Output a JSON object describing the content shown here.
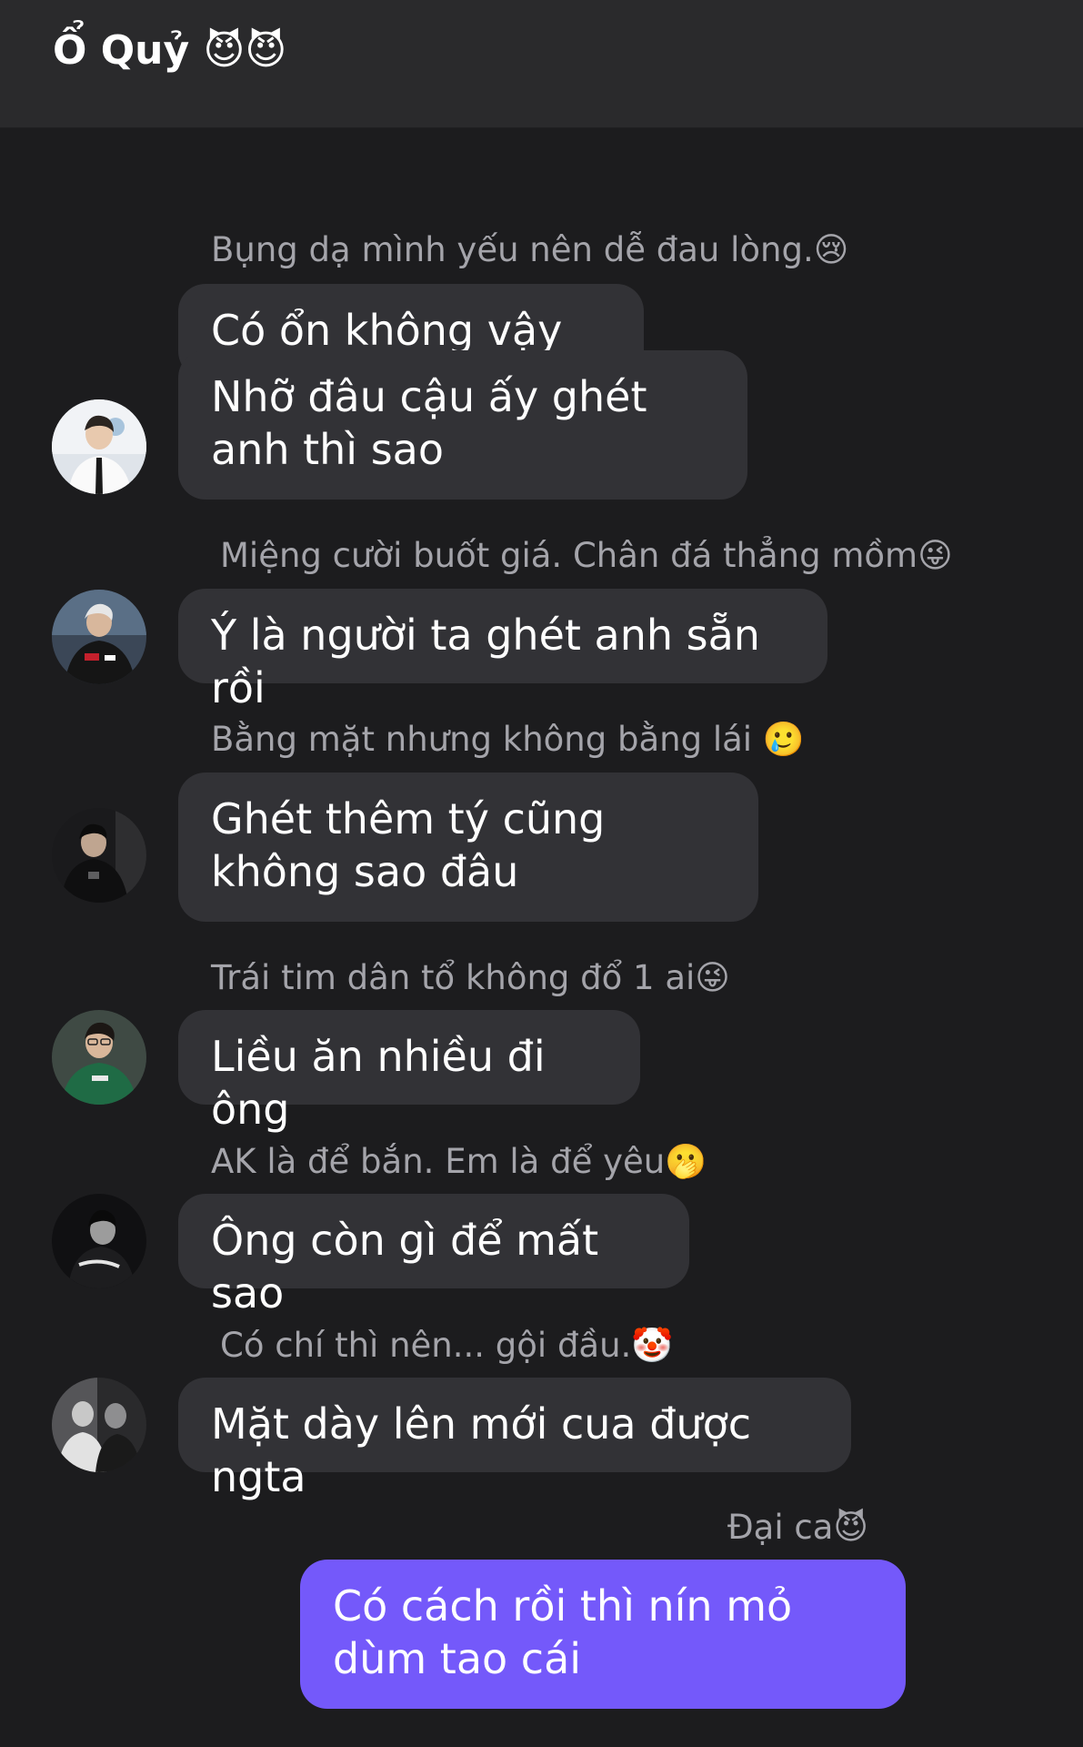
{
  "header": {
    "title": "Ổ Quỷ 😈😈"
  },
  "messages": [
    {
      "sender": "Bụng dạ mình yếu nên dễ đau lòng.😢",
      "text": "Có ổn không vậy 😿",
      "avatar": "avatar-boy-white-shirt",
      "mine": false
    },
    {
      "sender": "Miệng cười buốt giá. Chân đá thẳng mồm😜",
      "text": "Ý là người ta ghét anh sẵn rồi",
      "avatar": "avatar-player-jersey",
      "mine": false
    },
    {
      "sender": "Bằng mặt nhưng không bằng lái 🥲",
      "text": "Ghét thêm tý cũng không sao đâu",
      "avatar": "avatar-dark-photo",
      "mine": false
    },
    {
      "sender": "Trái tim dân tổ không đổ 1 ai😜",
      "text": "Liều ăn nhiều đi ông",
      "avatar": "avatar-green-jersey",
      "mine": false
    },
    {
      "sender": "AK là để bắn. Em là để yêu🫢",
      "text": "Ông còn gì để mất sao",
      "avatar": "avatar-black-white-photo",
      "mine": false
    },
    {
      "sender": "Có chí thì nên... gội đầu.🤡",
      "text": "Mặt dày lên mới cua được ngta",
      "avatar": "avatar-grayscale-group",
      "mine": false
    },
    {
      "sender": "Đại ca😈",
      "text": "Có cách rồi thì nín mỏ dùm tao cái",
      "mine": true
    }
  ],
  "colors": {
    "background": "#1c1c1e",
    "header": "#2a2a2c",
    "bubble_other": "#323236",
    "bubble_mine": "#7459fa",
    "sender_text": "#a4a4aa"
  }
}
